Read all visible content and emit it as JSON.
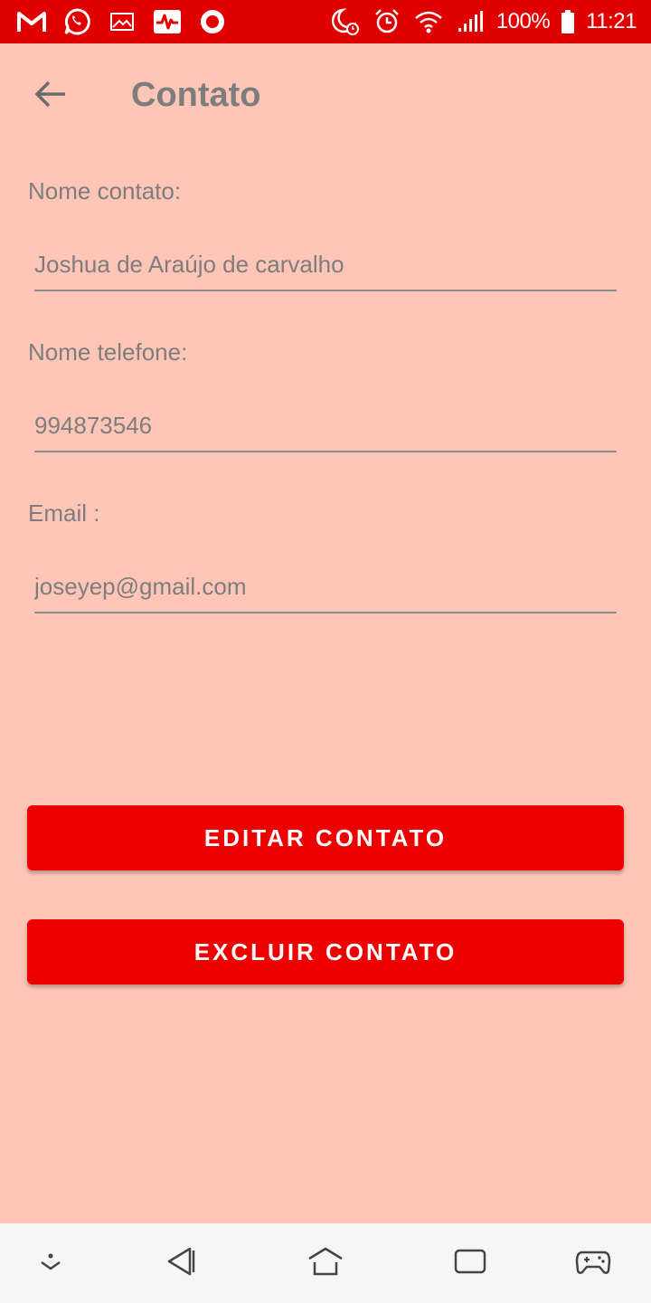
{
  "status_bar": {
    "battery_percent": "100%",
    "time": "11:21",
    "left_icons": [
      "gmail-icon",
      "whatsapp-icon",
      "gallery-icon",
      "health-monitor-icon",
      "record-icon"
    ],
    "right_icons": [
      "do-not-disturb-icon",
      "alarm-icon",
      "wifi-icon",
      "signal-icon",
      "battery-icon"
    ],
    "colors": {
      "background": "#e00000",
      "foreground": "#ffffff"
    }
  },
  "app_bar": {
    "title": "Contato",
    "back_icon": "arrow-back-icon"
  },
  "form": {
    "name": {
      "label": "Nome contato:",
      "value": "Joshua de Araújo de carvalho"
    },
    "phone": {
      "label": "Nome telefone:",
      "value": "994873546"
    },
    "email": {
      "label": "Email :",
      "value": "joseyep@gmail.com"
    }
  },
  "actions": {
    "edit_label": "EDITAR CONTATO",
    "delete_label": "EXCLUIR CONTATO"
  },
  "nav_bar": {
    "icons": [
      "collapse-icon",
      "back-icon",
      "home-icon",
      "recents-icon",
      "game-genie-icon"
    ]
  },
  "colors": {
    "page_background": "#ffc6b8",
    "accent": "#ee0000",
    "text": "#7d7d7d",
    "nav_background": "#f6f6f6"
  }
}
